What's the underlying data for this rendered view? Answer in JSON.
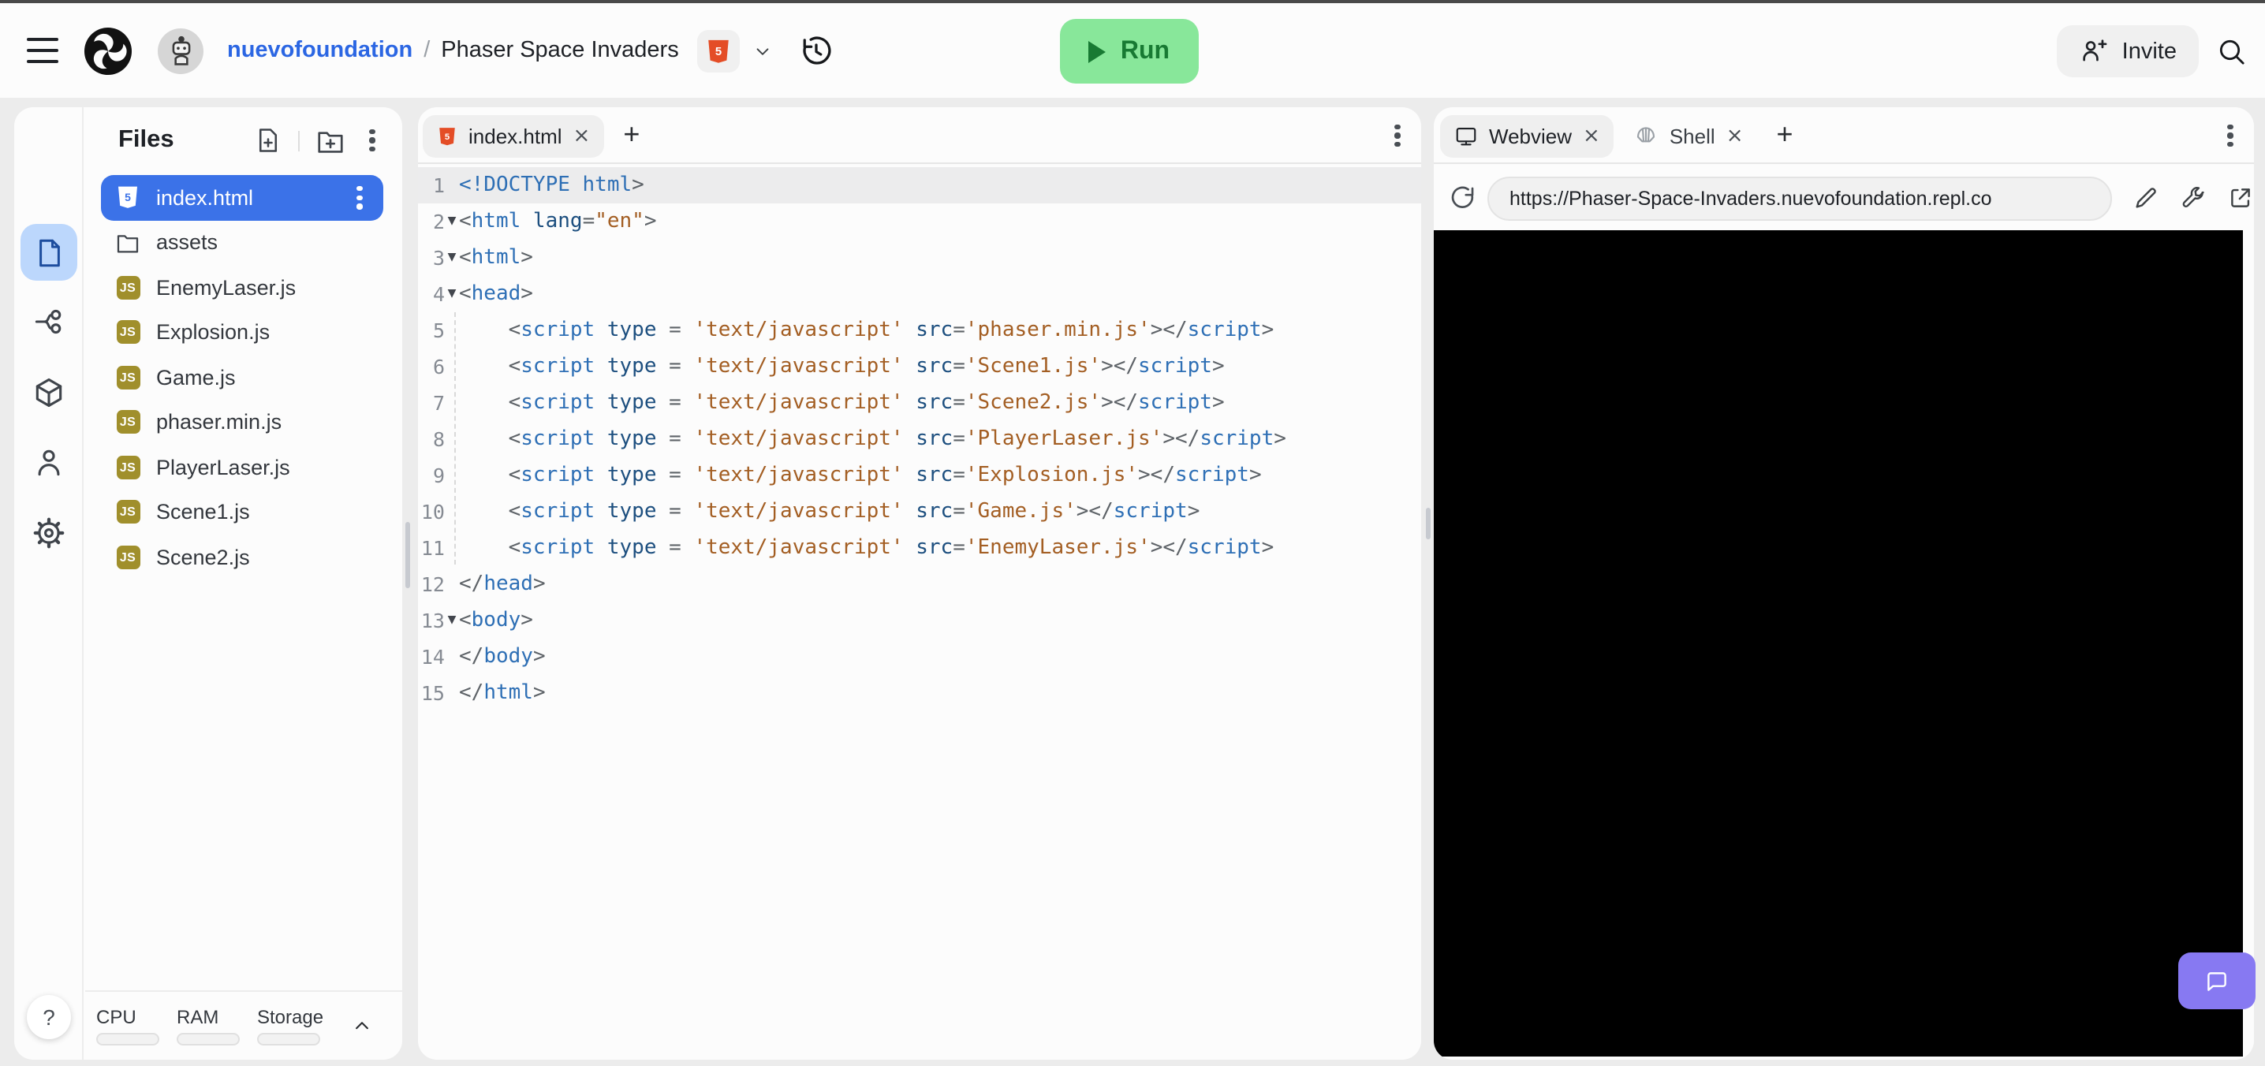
{
  "header": {
    "breadcrumb": {
      "owner": "nuevofoundation",
      "separator": "/",
      "project": "Phaser Space Invaders"
    },
    "run_label": "Run",
    "invite_label": "Invite"
  },
  "sidebar": {
    "items": [
      {
        "id": "files",
        "icon": "file-icon",
        "selected": true
      },
      {
        "id": "version-control",
        "icon": "fork-icon",
        "selected": false
      },
      {
        "id": "packages",
        "icon": "cube-icon",
        "selected": false
      },
      {
        "id": "account",
        "icon": "person-icon",
        "selected": false
      },
      {
        "id": "settings",
        "icon": "gear-icon",
        "selected": false
      }
    ],
    "help_label": "?"
  },
  "files": {
    "title": "Files",
    "items": [
      {
        "name": "index.html",
        "icon": "html5-icon",
        "selected": true
      },
      {
        "name": "assets",
        "icon": "folder-icon",
        "selected": false
      },
      {
        "name": "EnemyLaser.js",
        "icon": "js-icon",
        "selected": false
      },
      {
        "name": "Explosion.js",
        "icon": "js-icon",
        "selected": false
      },
      {
        "name": "Game.js",
        "icon": "js-icon",
        "selected": false
      },
      {
        "name": "phaser.min.js",
        "icon": "js-icon",
        "selected": false
      },
      {
        "name": "PlayerLaser.js",
        "icon": "js-icon",
        "selected": false
      },
      {
        "name": "Scene1.js",
        "icon": "js-icon",
        "selected": false
      },
      {
        "name": "Scene2.js",
        "icon": "js-icon",
        "selected": false
      }
    ]
  },
  "editor": {
    "tab": {
      "label": "index.html",
      "icon": "html5-icon"
    },
    "token_colors": {
      "punctuation": "#5E6368",
      "tag": "#2E6FB5",
      "attribute": "#1D4F7F",
      "string": "#A35E23"
    },
    "lines": [
      {
        "n": 1,
        "hl": true,
        "fold": false,
        "tokens": [
          [
            "t",
            "<!DOCTYPE html"
          ],
          [
            "p",
            ">"
          ]
        ]
      },
      {
        "n": 2,
        "hl": false,
        "fold": true,
        "tokens": [
          [
            "p",
            "<"
          ],
          [
            "t",
            "html"
          ],
          [
            "a",
            " lang"
          ],
          [
            "p",
            "="
          ],
          [
            "s",
            "\"en\""
          ],
          [
            "p",
            ">"
          ]
        ]
      },
      {
        "n": 3,
        "hl": false,
        "fold": true,
        "tokens": [
          [
            "p",
            "<"
          ],
          [
            "t",
            "html"
          ],
          [
            "p",
            ">"
          ]
        ]
      },
      {
        "n": 4,
        "hl": false,
        "fold": true,
        "tokens": [
          [
            "p",
            "<"
          ],
          [
            "t",
            "head"
          ],
          [
            "p",
            ">"
          ]
        ]
      },
      {
        "n": 5,
        "hl": false,
        "fold": false,
        "tokens": [
          [
            "p",
            "    <"
          ],
          [
            "t",
            "script"
          ],
          [
            "a",
            " type"
          ],
          [
            "p",
            " = "
          ],
          [
            "s",
            "'text/javascript'"
          ],
          [
            "a",
            " src"
          ],
          [
            "p",
            "="
          ],
          [
            "s",
            "'phaser.min.js'"
          ],
          [
            "p",
            "></"
          ],
          [
            "t",
            "script"
          ],
          [
            "p",
            ">"
          ]
        ]
      },
      {
        "n": 6,
        "hl": false,
        "fold": false,
        "tokens": [
          [
            "p",
            "    <"
          ],
          [
            "t",
            "script"
          ],
          [
            "a",
            " type"
          ],
          [
            "p",
            " = "
          ],
          [
            "s",
            "'text/javascript'"
          ],
          [
            "a",
            " src"
          ],
          [
            "p",
            "="
          ],
          [
            "s",
            "'Scene1.js'"
          ],
          [
            "p",
            "></"
          ],
          [
            "t",
            "script"
          ],
          [
            "p",
            ">"
          ]
        ]
      },
      {
        "n": 7,
        "hl": false,
        "fold": false,
        "tokens": [
          [
            "p",
            "    <"
          ],
          [
            "t",
            "script"
          ],
          [
            "a",
            " type"
          ],
          [
            "p",
            " = "
          ],
          [
            "s",
            "'text/javascript'"
          ],
          [
            "a",
            " src"
          ],
          [
            "p",
            "="
          ],
          [
            "s",
            "'Scene2.js'"
          ],
          [
            "p",
            "></"
          ],
          [
            "t",
            "script"
          ],
          [
            "p",
            ">"
          ]
        ]
      },
      {
        "n": 8,
        "hl": false,
        "fold": false,
        "tokens": [
          [
            "p",
            "    <"
          ],
          [
            "t",
            "script"
          ],
          [
            "a",
            " type"
          ],
          [
            "p",
            " = "
          ],
          [
            "s",
            "'text/javascript'"
          ],
          [
            "a",
            " src"
          ],
          [
            "p",
            "="
          ],
          [
            "s",
            "'PlayerLaser.js'"
          ],
          [
            "p",
            "></"
          ],
          [
            "t",
            "script"
          ],
          [
            "p",
            ">"
          ]
        ]
      },
      {
        "n": 9,
        "hl": false,
        "fold": false,
        "tokens": [
          [
            "p",
            "    <"
          ],
          [
            "t",
            "script"
          ],
          [
            "a",
            " type"
          ],
          [
            "p",
            " = "
          ],
          [
            "s",
            "'text/javascript'"
          ],
          [
            "a",
            " src"
          ],
          [
            "p",
            "="
          ],
          [
            "s",
            "'Explosion.js'"
          ],
          [
            "p",
            "></"
          ],
          [
            "t",
            "script"
          ],
          [
            "p",
            ">"
          ]
        ]
      },
      {
        "n": 10,
        "hl": false,
        "fold": false,
        "tokens": [
          [
            "p",
            "    <"
          ],
          [
            "t",
            "script"
          ],
          [
            "a",
            " type"
          ],
          [
            "p",
            " = "
          ],
          [
            "s",
            "'text/javascript'"
          ],
          [
            "a",
            " src"
          ],
          [
            "p",
            "="
          ],
          [
            "s",
            "'Game.js'"
          ],
          [
            "p",
            "></"
          ],
          [
            "t",
            "script"
          ],
          [
            "p",
            ">"
          ]
        ]
      },
      {
        "n": 11,
        "hl": false,
        "fold": false,
        "tokens": [
          [
            "p",
            "    <"
          ],
          [
            "t",
            "script"
          ],
          [
            "a",
            " type"
          ],
          [
            "p",
            " = "
          ],
          [
            "s",
            "'text/javascript'"
          ],
          [
            "a",
            " src"
          ],
          [
            "p",
            "="
          ],
          [
            "s",
            "'EnemyLaser.js'"
          ],
          [
            "p",
            "></"
          ],
          [
            "t",
            "script"
          ],
          [
            "p",
            ">"
          ]
        ]
      },
      {
        "n": 12,
        "hl": false,
        "fold": false,
        "tokens": [
          [
            "p",
            "</"
          ],
          [
            "t",
            "head"
          ],
          [
            "p",
            ">"
          ]
        ]
      },
      {
        "n": 13,
        "hl": false,
        "fold": true,
        "tokens": [
          [
            "p",
            "<"
          ],
          [
            "t",
            "body"
          ],
          [
            "p",
            ">"
          ]
        ]
      },
      {
        "n": 14,
        "hl": false,
        "fold": false,
        "tokens": [
          [
            "p",
            "</"
          ],
          [
            "t",
            "body"
          ],
          [
            "p",
            ">"
          ]
        ]
      },
      {
        "n": 15,
        "hl": false,
        "fold": false,
        "tokens": [
          [
            "p",
            "</"
          ],
          [
            "t",
            "html"
          ],
          [
            "p",
            ">"
          ]
        ]
      }
    ]
  },
  "webview": {
    "tabs": [
      {
        "label": "Webview",
        "icon": "monitor-icon",
        "active": true
      },
      {
        "label": "Shell",
        "icon": "shell-icon",
        "active": false
      }
    ],
    "url": "https://Phaser-Space-Invaders.nuevofoundation.repl.co"
  },
  "resources": {
    "labels": [
      "CPU",
      "RAM",
      "Storage"
    ]
  },
  "colors": {
    "selection_blue": "#3B72E8",
    "sidebar_selected_bg": "#BCD7FC",
    "sidebar_selected_fg": "#1D4D9E",
    "js_badge": "#A08F2C",
    "html5_orange": "#E44D26",
    "run_bg": "#88E79A",
    "run_fg": "#187A33",
    "chat_purple": "#8779F2",
    "link_blue": "#2B66E3",
    "panel_bg": "#FCFCFC",
    "page_bg": "#ECECEC"
  }
}
